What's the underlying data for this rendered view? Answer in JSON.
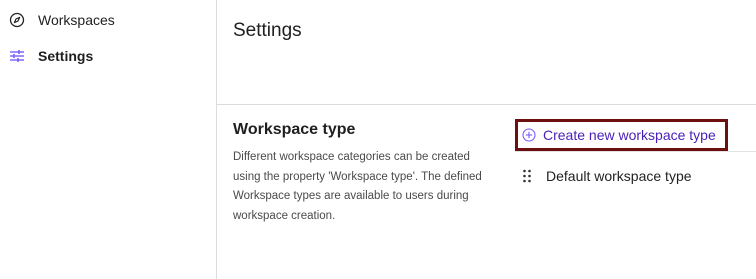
{
  "sidebar": {
    "items": [
      {
        "label": "Workspaces",
        "icon": "compass-icon"
      },
      {
        "label": "Settings",
        "icon": "sliders-icon",
        "active": true
      }
    ]
  },
  "main": {
    "title": "Settings",
    "workspace_type": {
      "title": "Workspace type",
      "description": "Different workspace categories can be created using the property 'Workspace type'. The defined Workspace types are available to users during workspace creation.",
      "create_button_label": "Create new workspace type",
      "types": [
        {
          "label": "Default workspace type"
        }
      ]
    }
  },
  "colors": {
    "accent": "#4a1fb8",
    "active_icon": "#7b5cff",
    "highlight_border": "#6b0f0f",
    "divider": "#dcdcdc"
  }
}
